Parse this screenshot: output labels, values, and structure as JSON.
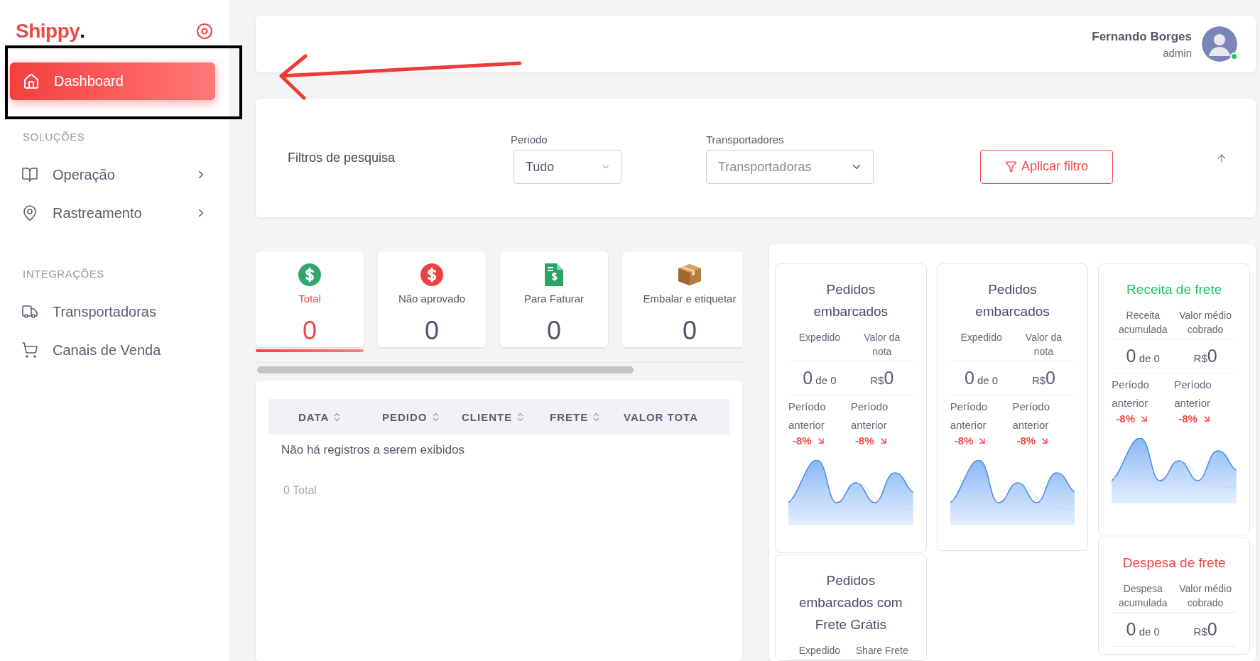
{
  "sidebar": {
    "logo": "Shippy",
    "logo_mark": ".",
    "items": [
      {
        "label": "Dashboard",
        "selected": true
      }
    ],
    "sections": [
      {
        "title": "SOLUÇÕES",
        "items": [
          {
            "label": "Operação",
            "expandable": true,
            "selected": false
          },
          {
            "label": "Rastreamento",
            "expandable": true,
            "selected": false
          }
        ]
      },
      {
        "title": "INTEGRAÇÕES",
        "items": [
          {
            "label": "Transportadoras",
            "expandable": false,
            "selected": false
          },
          {
            "label": "Canais de Venda",
            "expandable": false,
            "selected": false
          }
        ]
      }
    ]
  },
  "header": {
    "user": {
      "name": "Fernando Borges",
      "role": "admin",
      "online": true
    }
  },
  "filters": {
    "title": "Filtros de pesquisa",
    "fields": [
      {
        "label": "Periodo",
        "value": "Tudo"
      },
      {
        "label": "Transportadores",
        "placeholder": "Transportadoras"
      }
    ],
    "apply_button": "Aplicar filtro"
  },
  "status_tabs": [
    {
      "label": "Total",
      "count": "0",
      "selected": true
    },
    {
      "label": "Não aprovado",
      "count": "0",
      "selected": false
    },
    {
      "label": "Para Faturar",
      "count": "0",
      "selected": false
    },
    {
      "label": "Embalar e etiquetar",
      "count": "0",
      "selected": false
    }
  ],
  "table": {
    "columns": [
      "DATA",
      "PEDIDO",
      "CLIENTE",
      "FRETE",
      "VALOR TOTA"
    ],
    "empty_message": "Não há registros a serem exibidos",
    "total": "0 Total"
  },
  "metric_panel": {
    "columns": [
      {
        "cards": [
          {
            "title": "Pedidos embarcados",
            "color": "#4a4a68",
            "headers": [
              "Expedido",
              "Valor da nota"
            ],
            "values": [
              {
                "value": "0",
                "unit": "de 0"
              },
              {
                "prefix": "R$",
                "value": "0"
              }
            ],
            "comparisons": [
              {
                "label": "Período anterior",
                "change": "-8%"
              },
              {
                "label": "Período anterior",
                "change": "-8%"
              }
            ],
            "sparkline": true
          },
          {
            "title": "Pedidos embarcados com Frete Grátis",
            "color": "#4a4a68",
            "headers": [
              "Expedido",
              "Share Frete"
            ]
          }
        ]
      },
      {
        "cards": [
          {
            "title": "Pedidos embarcados",
            "color": "#4a4a68",
            "headers": [
              "Expedido",
              "Valor da nota"
            ],
            "values": [
              {
                "value": "0",
                "unit": "de 0"
              },
              {
                "prefix": "R$",
                "value": "0"
              }
            ],
            "comparisons": [
              {
                "label": "Período anterior",
                "change": "-8%"
              },
              {
                "label": "Período anterior",
                "change": "-8%"
              }
            ],
            "sparkline": true
          }
        ]
      },
      {
        "cards": [
          {
            "title": "Receita de frete",
            "color": "#22c55e",
            "headers": [
              "Receita acumulada",
              "Valor médio cobrado"
            ],
            "values": [
              {
                "value": "0",
                "unit": "de 0"
              },
              {
                "prefix": "R$",
                "value": "0"
              }
            ],
            "comparisons": [
              {
                "label": "Período anterior",
                "change": "-8%"
              },
              {
                "label": "Período anterior",
                "change": "-8%"
              }
            ],
            "sparkline": true
          },
          {
            "title": "Despesa de frete",
            "color": "#ef4444",
            "headers": [
              "Despesa acumulada",
              "Valor médio cobrado"
            ],
            "values": [
              {
                "value": "0",
                "unit": "de 0"
              },
              {
                "prefix": "R$",
                "value": "0"
              }
            ]
          }
        ]
      }
    ]
  },
  "annotations": {
    "highlight_frame": true,
    "arrow": true
  }
}
